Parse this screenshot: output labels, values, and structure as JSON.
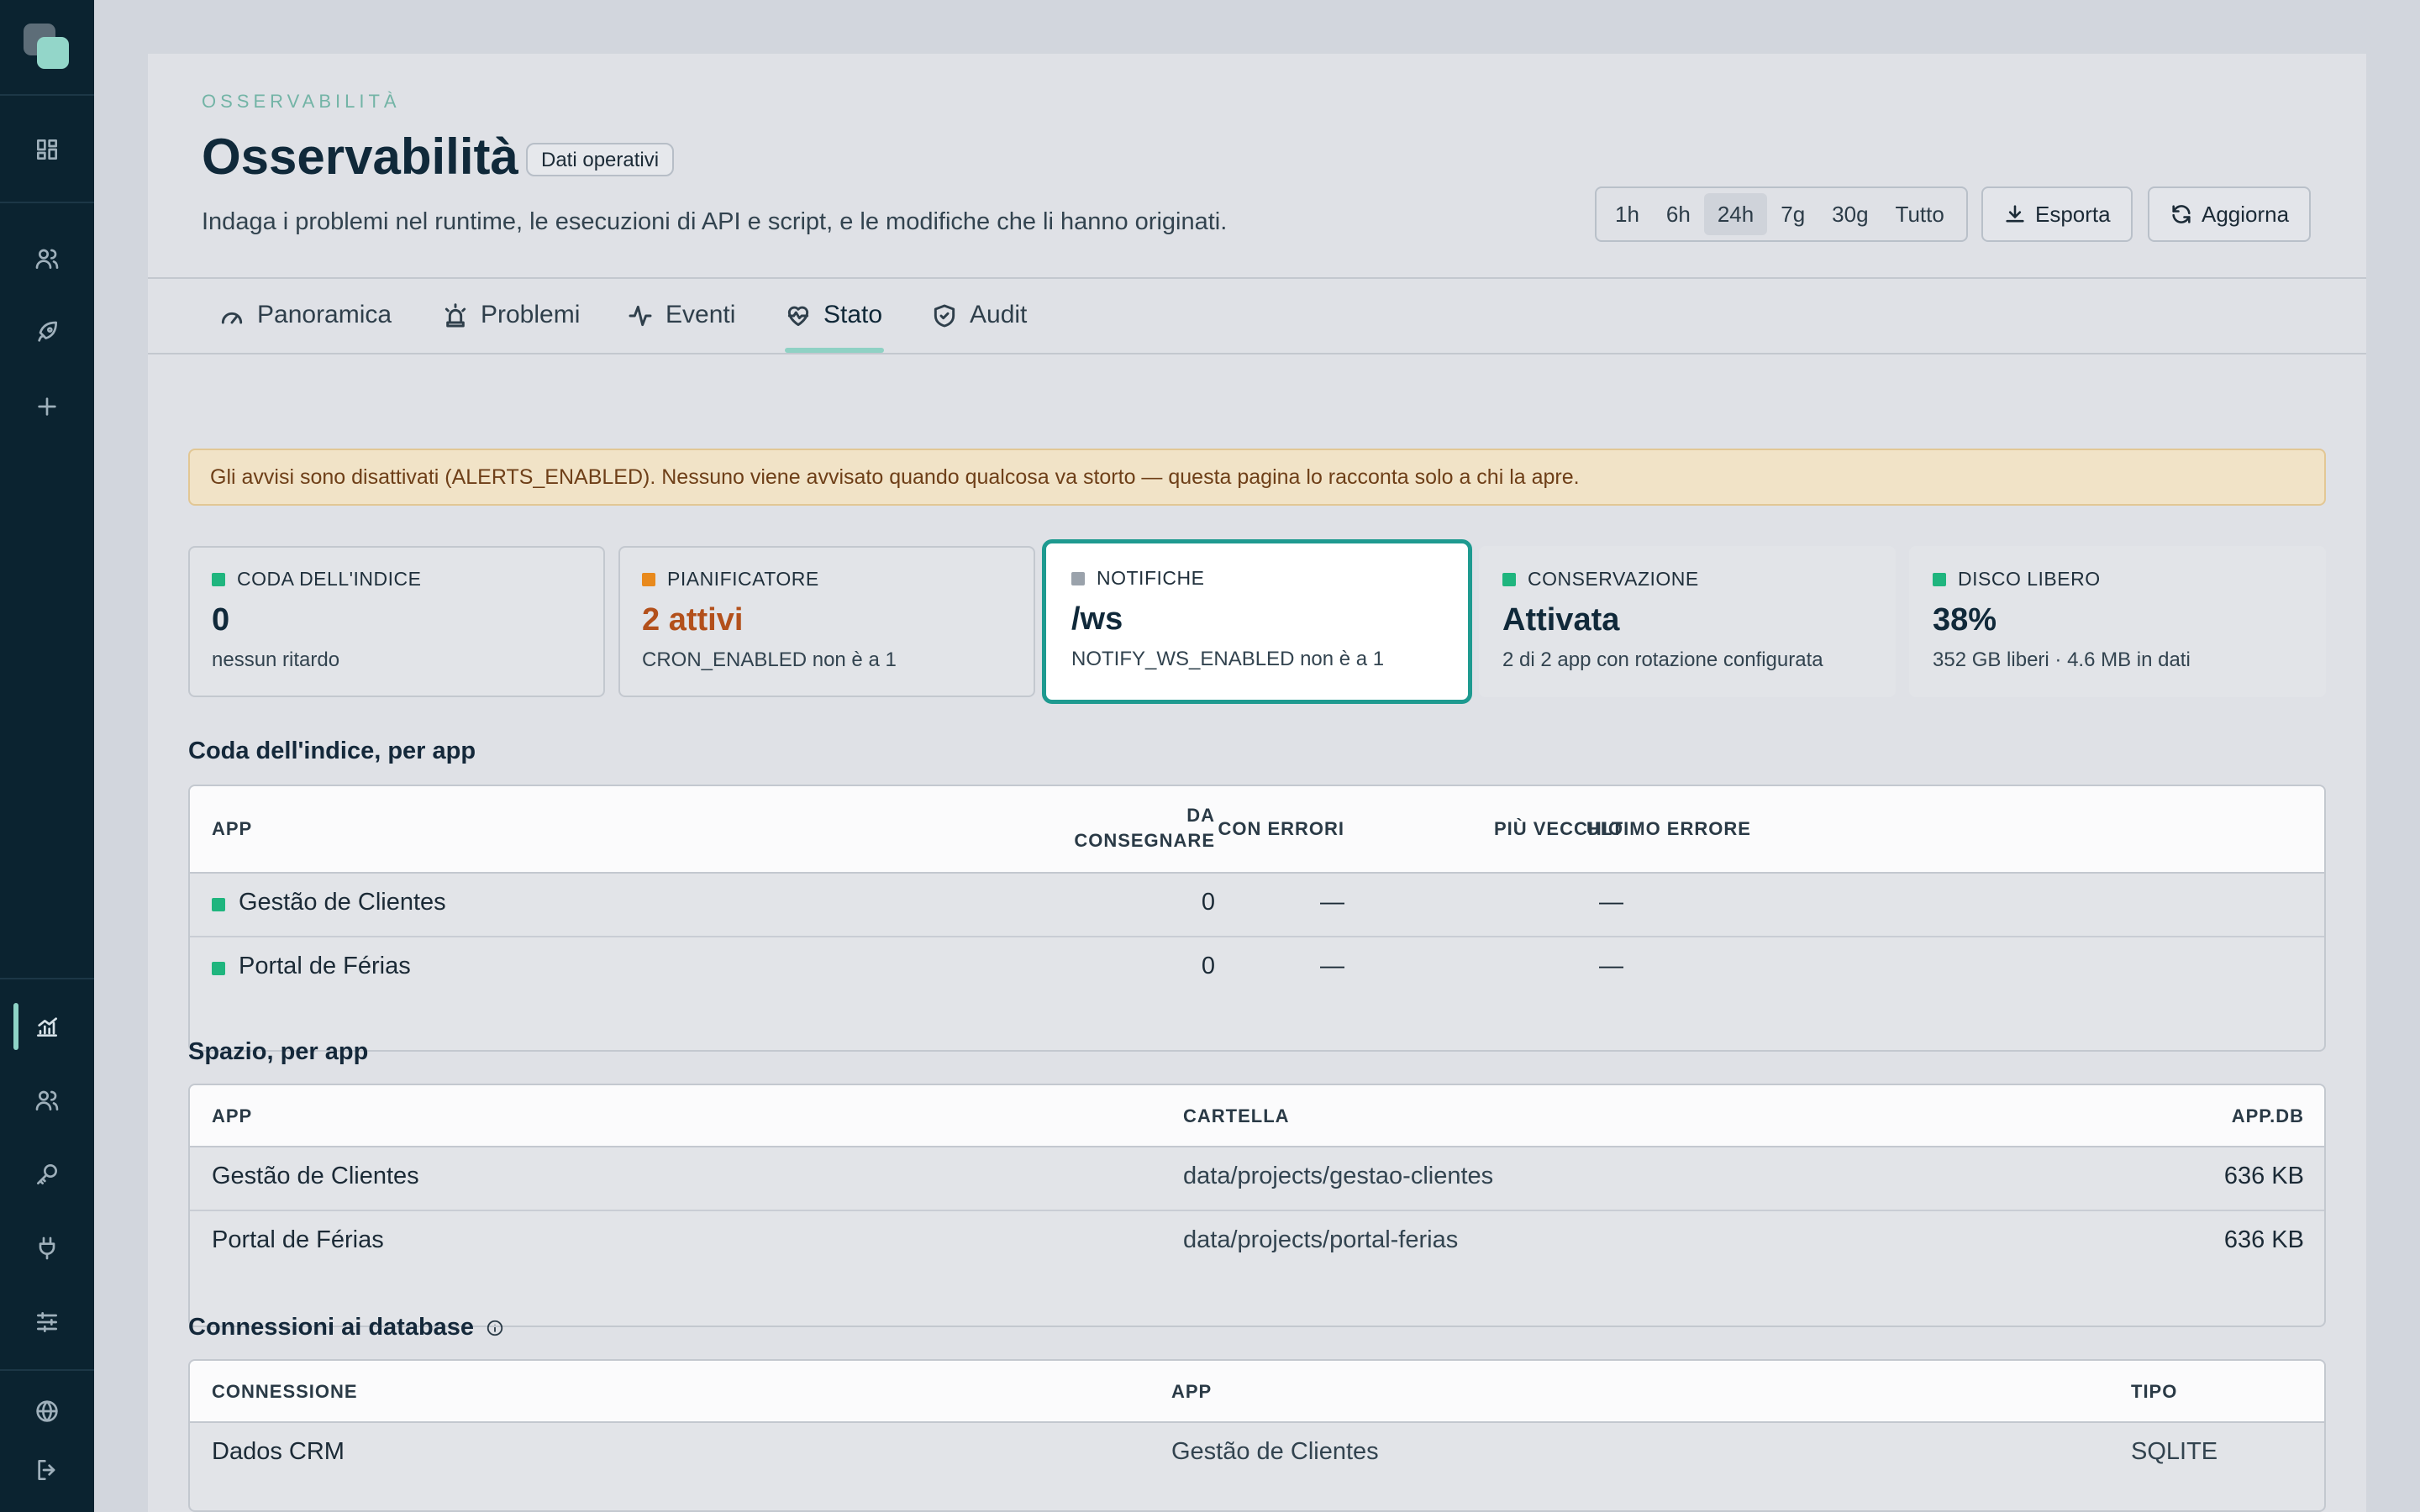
{
  "sidebar": {
    "icons": [
      "dashboard-icon",
      "users-icon",
      "rocket-icon",
      "plus-icon",
      "chart-icon",
      "users-icon",
      "key-icon",
      "plug-icon",
      "sliders-icon",
      "globe-icon",
      "logout-icon"
    ]
  },
  "header": {
    "eyebrow": "OSSERVABILITÀ",
    "title": "Osservabilità",
    "badge": "Dati operativi",
    "subtitle": "Indaga i problemi nel runtime, le esecuzioni di API e script, e le modifiche che li hanno originati.",
    "ranges": [
      "1h",
      "6h",
      "24h",
      "7g",
      "30g",
      "Tutto"
    ],
    "selected_range": "24h",
    "export_label": "Esporta",
    "refresh_label": "Aggiorna"
  },
  "tabs": [
    {
      "label": "Panoramica",
      "icon": "gauge-icon"
    },
    {
      "label": "Problemi",
      "icon": "siren-icon"
    },
    {
      "label": "Eventi",
      "icon": "activity-icon"
    },
    {
      "label": "Stato",
      "icon": "heart-pulse-icon"
    },
    {
      "label": "Audit",
      "icon": "shield-check-icon"
    }
  ],
  "active_tab": "Stato",
  "alert": "Gli avvisi sono disattivati (ALERTS_ENABLED). Nessuno viene avvisato quando qualcosa va storto — questa pagina lo racconta solo a chi la apre.",
  "cards": [
    {
      "label": "CODA DELL'INDICE",
      "value": "0",
      "sub": "nessun ritardo",
      "color": "#1fb57e"
    },
    {
      "label": "PIANIFICATORE",
      "value": "2 attivi",
      "sub": "CRON_ENABLED non è a 1",
      "color": "#e8891c"
    },
    {
      "label": "NOTIFICHE",
      "value": "/ws",
      "sub": "NOTIFY_WS_ENABLED non è a 1",
      "color": "#9aa2ab"
    },
    {
      "label": "CONSERVAZIONE",
      "value": "Attivata",
      "sub": "2 di 2 app con rotazione configurata",
      "color": "#1fb57e"
    },
    {
      "label": "DISCO LIBERO",
      "value": "38%",
      "sub": "352 GB liberi · 4.6 MB in dati",
      "color": "#1fb57e"
    }
  ],
  "queue": {
    "title": "Coda dell'indice, per app",
    "headers": {
      "app": "APP",
      "pending_1": "DA",
      "pending_2": "CONSEGNARE",
      "errors": "CON ERRORI",
      "oldest": "PIÙ VECCHIO",
      "last_error": "ULTIMO ERRORE"
    },
    "rows": [
      {
        "app": "Gestão de Clientes",
        "pending": "0",
        "errors": "—",
        "oldest": "—",
        "last_error": ""
      },
      {
        "app": "Portal de Férias",
        "pending": "0",
        "errors": "—",
        "oldest": "—",
        "last_error": ""
      }
    ]
  },
  "space": {
    "title": "Spazio, per app",
    "headers": {
      "app": "APP",
      "folder": "CARTELLA",
      "db": "APP.DB"
    },
    "rows": [
      {
        "app": "Gestão de Clientes",
        "folder": "data/projects/gestao-clientes",
        "db": "636 KB"
      },
      {
        "app": "Portal de Férias",
        "folder": "data/projects/portal-ferias",
        "db": "636 KB"
      }
    ]
  },
  "connections": {
    "title": "Connessioni ai database",
    "headers": {
      "connection": "CONNESSIONE",
      "app": "APP",
      "type": "TIPO"
    },
    "rows": [
      {
        "connection": "Dados CRM",
        "app": "Gestão de Clientes",
        "type": "SQLITE"
      }
    ]
  }
}
